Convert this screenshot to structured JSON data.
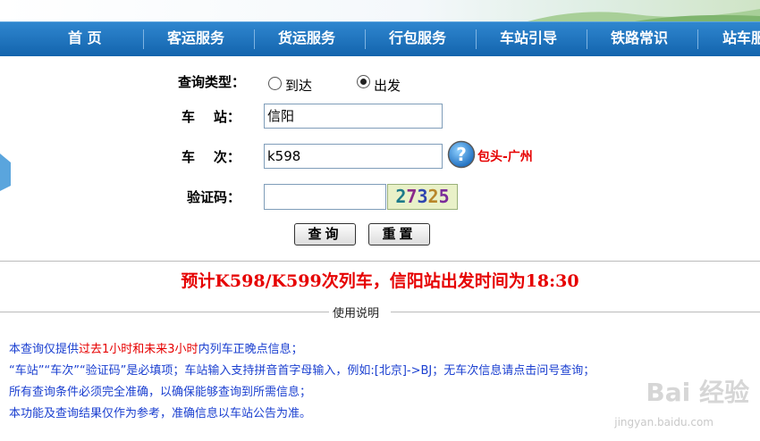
{
  "nav": {
    "items": [
      "首 页",
      "客运服务",
      "货运服务",
      "行包服务",
      "车站引导",
      "铁路常识",
      "站车服"
    ]
  },
  "form": {
    "query_type_label": "查询类型：",
    "radio_arrive": "到达",
    "radio_depart": "出发",
    "selected": "出发",
    "station_label": "车    站：",
    "station_value": "信阳",
    "train_label": "车    次：",
    "train_value": "k598",
    "route_hint": "包头-广州",
    "captcha_label": "验证码：",
    "captcha_value": "",
    "captcha_text": "27325",
    "query_button": "查询",
    "reset_button": "重置"
  },
  "result": {
    "text": "预计K598/K599次列车，信阳站出发时间为18:30"
  },
  "instructions": {
    "title": "使用说明",
    "line1_a": "本查询仅提供",
    "line1_red": "过去1小时和未来3小时",
    "line1_b": "内列车正晚点信息；",
    "line2": "“车站”“车次”“验证码”是必填项；车站输入支持拼音首字母输入，例如:[北京]->BJ；无车次信息请点击问号查询；",
    "line3": "所有查询条件必须完全准确，以确保能够查询到所需信息；",
    "line4": "本功能及查询结果仅作为参考，准确信息以车站公告为准。"
  },
  "watermark": {
    "brand": "Bai 经验",
    "url": "jingyan.baidu.com"
  },
  "colors": {
    "nav_bg": "#1b6db8",
    "result_red": "#e60000",
    "notes_blue": "#1a3fd0"
  }
}
